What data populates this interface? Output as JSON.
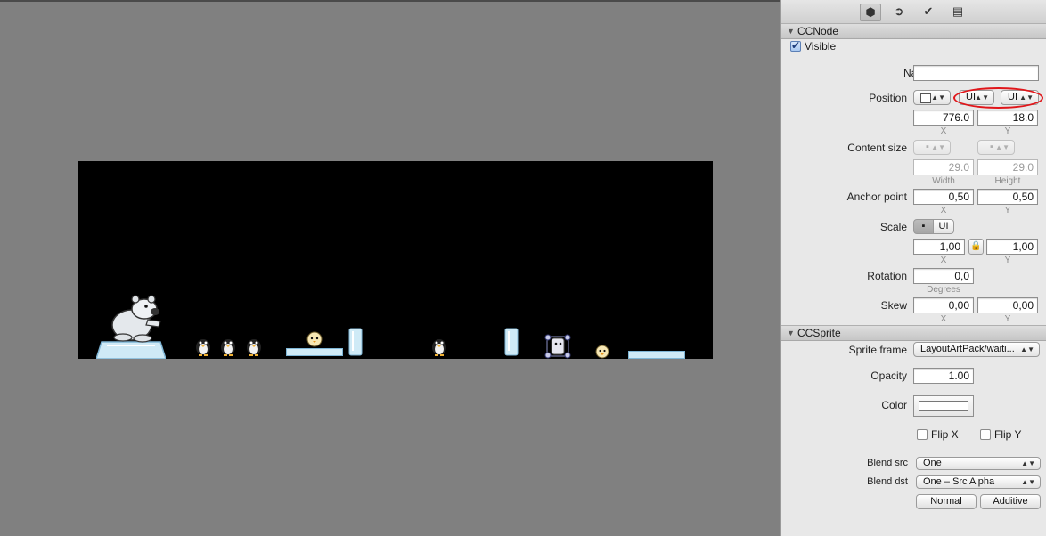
{
  "inspector": {
    "tabs": [
      {
        "name": "node-properties-icon",
        "glyph": "▾"
      },
      {
        "name": "code-connections-icon",
        "glyph": "➔"
      },
      {
        "name": "animation-icon",
        "glyph": "✔"
      },
      {
        "name": "templates-icon",
        "glyph": "▤"
      }
    ],
    "ccnode": {
      "title": "CCNode",
      "visible_label": "Visible",
      "visible": true,
      "name_label": "Name",
      "name_value": "",
      "position_label": "Position",
      "position_ref_value": "",
      "position_x_unit": "UI",
      "position_y_unit": "UI",
      "position_x": "776.0",
      "position_y": "18.0",
      "x_caption": "X",
      "y_caption": "Y",
      "content_size_label": "Content size",
      "content_w_unit": "▪",
      "content_h_unit": "▪",
      "width": "29.0",
      "height": "29.0",
      "width_caption": "Width",
      "height_caption": "Height",
      "anchor_label": "Anchor point",
      "anchor_x": "0,50",
      "anchor_y": "0,50",
      "scale_label": "Scale",
      "scale_seg_a": "▪",
      "scale_seg_b": "UI",
      "scale_x": "1,00",
      "scale_y": "1,00",
      "rotation_label": "Rotation",
      "rotation": "0,0",
      "degrees_caption": "Degrees",
      "skew_label": "Skew",
      "skew_x": "0,00",
      "skew_y": "0,00"
    },
    "ccsprite": {
      "title": "CCSprite",
      "sprite_frame_label": "Sprite frame",
      "sprite_frame": "LayoutArtPack/waiti...",
      "opacity_label": "Opacity",
      "opacity": "1.00",
      "color_label": "Color",
      "color": "#ffffff",
      "flip_x_label": "Flip X",
      "flip_y_label": "Flip Y",
      "flip_x": false,
      "flip_y": false,
      "blend_src_label": "Blend src",
      "blend_src": "One",
      "blend_dst_label": "Blend dst",
      "blend_dst": "One – Src Alpha",
      "normal_button": "Normal",
      "additive_button": "Additive"
    }
  },
  "colors": {
    "workspace": "#808080",
    "stage": "#000000",
    "highlight_oval": "#e0161a"
  }
}
